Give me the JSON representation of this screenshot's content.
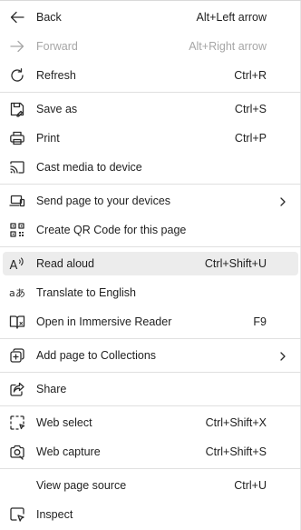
{
  "menu": {
    "back": {
      "label": "Back",
      "shortcut": "Alt+Left arrow",
      "icon": "arrow-left-icon"
    },
    "forward": {
      "label": "Forward",
      "shortcut": "Alt+Right arrow",
      "icon": "arrow-right-icon",
      "disabled": true
    },
    "refresh": {
      "label": "Refresh",
      "shortcut": "Ctrl+R",
      "icon": "refresh-icon"
    },
    "save_as": {
      "label": "Save as",
      "shortcut": "Ctrl+S",
      "icon": "save-icon"
    },
    "print": {
      "label": "Print",
      "shortcut": "Ctrl+P",
      "icon": "printer-icon"
    },
    "cast": {
      "label": "Cast media to device",
      "icon": "cast-icon"
    },
    "send_page": {
      "label": "Send page to your devices",
      "icon": "devices-icon",
      "submenu": true
    },
    "qr_code": {
      "label": "Create QR Code for this page",
      "icon": "qr-code-icon"
    },
    "read_aloud": {
      "label": "Read aloud",
      "shortcut": "Ctrl+Shift+U",
      "icon": "read-aloud-icon",
      "hovered": true
    },
    "translate": {
      "label": "Translate to English",
      "icon": "translate-icon"
    },
    "immersive_reader": {
      "label": "Open in Immersive Reader",
      "shortcut": "F9",
      "icon": "immersive-reader-icon"
    },
    "collections": {
      "label": "Add page to Collections",
      "icon": "collections-icon",
      "submenu": true
    },
    "share": {
      "label": "Share",
      "icon": "share-icon"
    },
    "web_select": {
      "label": "Web select",
      "shortcut": "Ctrl+Shift+X",
      "icon": "web-select-icon"
    },
    "web_capture": {
      "label": "Web capture",
      "shortcut": "Ctrl+Shift+S",
      "icon": "web-capture-icon"
    },
    "view_source": {
      "label": "View page source",
      "shortcut": "Ctrl+U"
    },
    "inspect": {
      "label": "Inspect",
      "icon": "inspect-icon"
    }
  },
  "colors": {
    "hover_bg": "#ececec",
    "text": "#1f1f1f",
    "disabled_text": "#a6a6a6",
    "separator": "#e0e0e0"
  }
}
